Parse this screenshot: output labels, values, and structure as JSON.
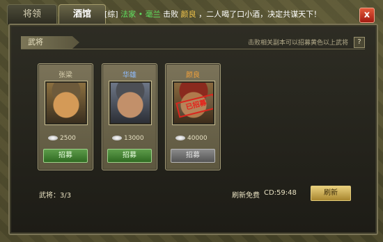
{
  "tabs": [
    {
      "label": "将领"
    },
    {
      "label": "酒馆"
    }
  ],
  "ticker": {
    "pre": "[综]",
    "player": "法家",
    "sep": "•",
    "hero": "毫兰",
    "mid": "击败",
    "target": "颜良",
    "text": "，二人喝了口小酒，决定共谋天下！"
  },
  "close_label": "x",
  "section": {
    "title": "武将",
    "hint": "击败相关副本可以招募黄色以上武将",
    "help_label": "?"
  },
  "cards": [
    {
      "name": "张梁",
      "cost": "2500",
      "button": "招募",
      "name_color": "default"
    },
    {
      "name": "华雄",
      "cost": "13000",
      "button": "招募",
      "name_color": "blue"
    },
    {
      "name": "颜良",
      "cost": "40000",
      "button": "招募",
      "stamp": "已招募",
      "name_color": "orange"
    }
  ],
  "footer": {
    "count": "武将：3/3",
    "refresh_free": "刷新免费",
    "cd": "CD:59:48",
    "refresh_button": "刷新"
  },
  "colors": {
    "recruit_green": "#3e7c2f",
    "recruited_gray": "#6e6e6e",
    "stamp_red": "#d8261e",
    "refresh_gold": "#c9a64a"
  }
}
